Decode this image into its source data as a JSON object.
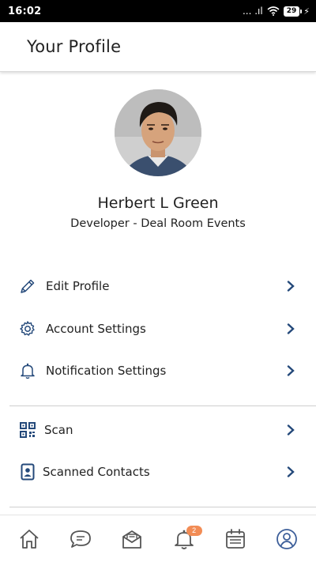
{
  "status_bar": {
    "time": "16:02",
    "signal_text": "... .ıl",
    "battery_level": "29"
  },
  "header": {
    "title": "Your Profile"
  },
  "profile": {
    "name": "Herbert L Green",
    "role": "Developer - Deal Room Events"
  },
  "menu_section_1": [
    {
      "label": "Edit Profile",
      "icon": "pencil-icon"
    },
    {
      "label": "Account Settings",
      "icon": "gear-icon"
    },
    {
      "label": "Notification Settings",
      "icon": "bell-icon"
    }
  ],
  "menu_section_2": [
    {
      "label": "Scan",
      "icon": "qr-code-icon"
    },
    {
      "label": "Scanned Contacts",
      "icon": "contact-card-icon"
    }
  ],
  "bottom_nav": {
    "items": [
      "home-icon",
      "chat-icon",
      "mail-icon",
      "bell-icon",
      "calendar-icon",
      "profile-icon"
    ],
    "notification_badge": "2",
    "active_item": "profile-icon"
  },
  "colors": {
    "accent": "#24497a",
    "nav_icon": "#555555",
    "badge": "#f28c55",
    "active_nav": "#3d5f9a"
  }
}
